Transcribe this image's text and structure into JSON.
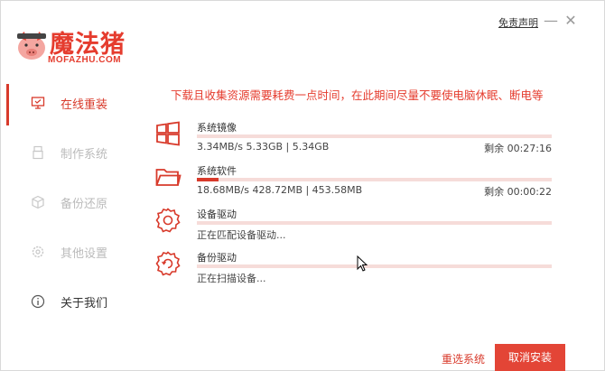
{
  "app": {
    "brand_cn": "魔法猪",
    "brand_en": "MOFAZHU.COM",
    "disclaimer": "免责声明",
    "minimize_glyph": "—",
    "close_glyph": "✕"
  },
  "sidebar": {
    "items": [
      {
        "label": "在线重装",
        "icon": "monitor-icon",
        "active": true
      },
      {
        "label": "制作系统",
        "icon": "usb-icon",
        "active": false
      },
      {
        "label": "备份还原",
        "icon": "backup-icon",
        "active": false
      },
      {
        "label": "其他设置",
        "icon": "gear-icon",
        "active": false
      },
      {
        "label": "关于我们",
        "icon": "info-icon",
        "active": false
      }
    ]
  },
  "main": {
    "notice": "下载且收集资源需要耗费一点时间，在此期间尽量不要使电脑休眠、断电等",
    "tasks": [
      {
        "name": "系统镜像",
        "icon": "windows-icon",
        "detail": "3.34MB/s 5.33GB | 5.34GB",
        "remaining": "剩余 00:27:16",
        "progress": 0.0
      },
      {
        "name": "系统软件",
        "icon": "folder-icon",
        "detail": "18.68MB/s 428.72MB | 453.58MB",
        "remaining": "剩余 00:00:22",
        "progress": 0.06
      },
      {
        "name": "设备驱动",
        "icon": "driver-gear-icon",
        "detail": "正在匹配设备驱动...",
        "remaining": "",
        "progress": 0.0
      },
      {
        "name": "备份驱动",
        "icon": "backup-gear-icon",
        "detail": "正在扫描设备...",
        "remaining": "",
        "progress": 0.0
      }
    ]
  },
  "footer": {
    "reselect_label": "重选系统",
    "cancel_label": "取消安装"
  },
  "colors": {
    "accent": "#d83a2b",
    "track": "#f6dcd9",
    "inactive_text": "#bbbbbb"
  }
}
